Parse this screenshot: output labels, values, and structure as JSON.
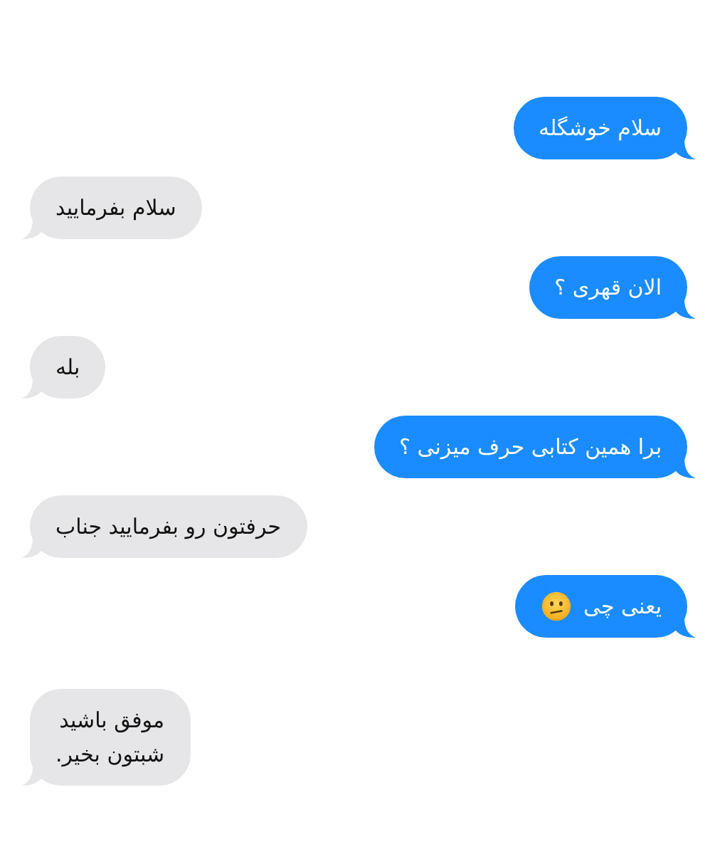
{
  "messages": [
    {
      "kind": "sent",
      "text": "سلام خوشگله"
    },
    {
      "kind": "received",
      "text": "سلام بفرمایید"
    },
    {
      "kind": "sent",
      "text": "الان قهری ؟"
    },
    {
      "kind": "received",
      "text": "بله"
    },
    {
      "kind": "sent",
      "text": "برا همین کتابی حرف میزنی ؟"
    },
    {
      "kind": "received",
      "text": "حرفتون رو بفرمایید جناب"
    },
    {
      "kind": "sent",
      "text": "یعنی چی",
      "icon": {
        "kind": "confused"
      }
    },
    {
      "kind": "received",
      "text": "موفق باشید\nشبتون بخیر."
    }
  ]
}
